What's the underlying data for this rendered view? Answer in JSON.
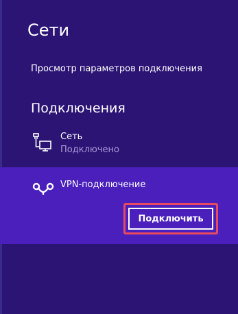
{
  "panel": {
    "title": "Сети",
    "settings_link": "Просмотр параметров подключения",
    "section_heading": "Подключения"
  },
  "connections": {
    "network": {
      "icon": "ethernet-network-icon",
      "name": "Сеть",
      "status": "Подключено"
    },
    "vpn": {
      "icon": "vpn-link-icon",
      "name": "VPN-подключение",
      "button_label": "Подключить"
    }
  },
  "colors": {
    "panel_background": "#2c1475",
    "selected_item_background": "#4a1fbb",
    "secondary_text": "#a89ad8",
    "highlight_frame": "#e84a5f"
  }
}
